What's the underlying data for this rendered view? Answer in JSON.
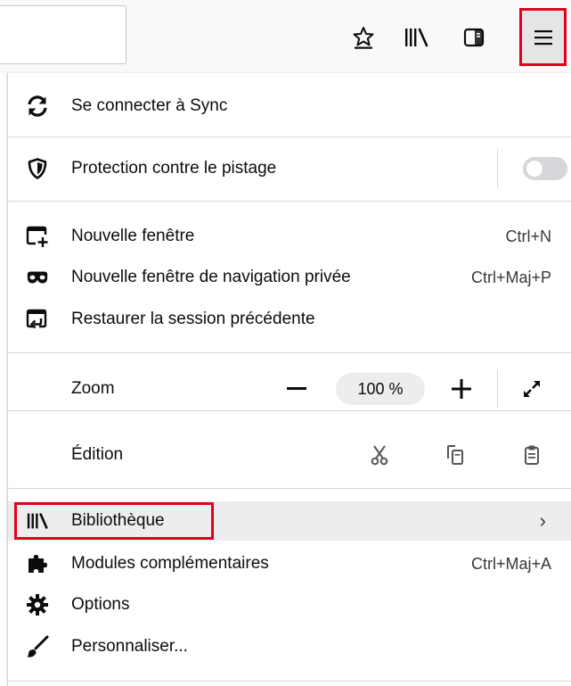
{
  "colors": {
    "highlight": "#e2001a",
    "hover": "#ededf0",
    "separator": "#d7d7db"
  },
  "toolbar": {
    "icons": [
      "bookmark-star-icon",
      "library-icon",
      "sidebar-icon",
      "hamburger-menu-icon"
    ]
  },
  "menu": {
    "sync": {
      "label": "Se connecter à Sync",
      "icon": "sync-icon"
    },
    "tracking": {
      "label": "Protection contre le pistage",
      "icon": "shield-icon",
      "toggle_on": false
    },
    "new_window": {
      "label": "Nouvelle fenêtre",
      "shortcut": "Ctrl+N",
      "icon": "new-window-icon"
    },
    "private_window": {
      "label": "Nouvelle fenêtre de navigation privée",
      "shortcut": "Ctrl+Maj+P",
      "icon": "private-mask-icon"
    },
    "restore_session": {
      "label": "Restaurer la session précédente",
      "icon": "restore-session-icon"
    },
    "zoom": {
      "label": "Zoom",
      "value": "100 %"
    },
    "edit": {
      "label": "Édition"
    },
    "library": {
      "label": "Bibliothèque",
      "icon": "library-icon"
    },
    "addons": {
      "label": "Modules complémentaires",
      "shortcut": "Ctrl+Maj+A",
      "icon": "puzzle-icon"
    },
    "options": {
      "label": "Options",
      "icon": "gear-icon"
    },
    "customize": {
      "label": "Personnaliser...",
      "icon": "paintbrush-icon"
    }
  }
}
